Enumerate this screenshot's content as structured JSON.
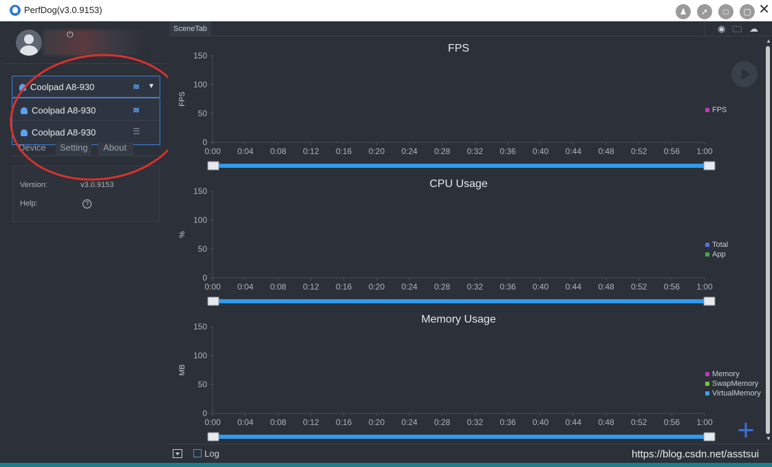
{
  "window": {
    "title": "PerfDog(v3.0.9153)"
  },
  "sidebar": {
    "selected_device": "Coolpad A8-930",
    "device_options": [
      {
        "name": "Coolpad A8-930",
        "connection": "usb"
      },
      {
        "name": "Coolpad A8-930",
        "connection": "wifi"
      }
    ],
    "tabs": [
      "Device",
      "Setting",
      "About"
    ],
    "info": {
      "version_label": "Version:",
      "version_value": "v3.0.9153",
      "help_label": "Help:"
    }
  },
  "main": {
    "scene_tab": "SceneTab",
    "log_label": "Log",
    "watermark": "https://blog.csdn.net/asstsui"
  },
  "colors": {
    "accent": "#3f7ee0",
    "slider": "#2f9bef",
    "fps": "#c038b8",
    "cpu_total": "#5a6fe0",
    "cpu_app": "#3fae49",
    "memory": "#c038b8",
    "swap_memory": "#7bc43a",
    "virtual_memory": "#3f9ff0",
    "annotation_circle": "#d9322a"
  },
  "chart_data": [
    {
      "type": "line",
      "title": "FPS",
      "ylabel": "FPS",
      "xlabel": "",
      "x": [
        "0:00",
        "0:04",
        "0:08",
        "0:12",
        "0:16",
        "0:20",
        "0:24",
        "0:28",
        "0:32",
        "0:36",
        "0:40",
        "0:44",
        "0:48",
        "0:52",
        "0:56",
        "1:00"
      ],
      "yticks": [
        "0",
        "50",
        "100",
        "150"
      ],
      "ylim": [
        0,
        150
      ],
      "legend_position": "right",
      "series": [
        {
          "name": "FPS",
          "values": []
        }
      ]
    },
    {
      "type": "line",
      "title": "CPU Usage",
      "ylabel": "%",
      "xlabel": "",
      "x": [
        "0:00",
        "0:04",
        "0:08",
        "0:12",
        "0:16",
        "0:20",
        "0:24",
        "0:28",
        "0:32",
        "0:36",
        "0:40",
        "0:44",
        "0:48",
        "0:52",
        "0:56",
        "1:00"
      ],
      "yticks": [
        "0",
        "50",
        "100",
        "150"
      ],
      "ylim": [
        0,
        150
      ],
      "legend_position": "right",
      "series": [
        {
          "name": "Total",
          "values": []
        },
        {
          "name": "App",
          "values": []
        }
      ]
    },
    {
      "type": "line",
      "title": "Memory Usage",
      "ylabel": "MB",
      "xlabel": "",
      "x": [
        "0:00",
        "0:04",
        "0:08",
        "0:12",
        "0:16",
        "0:20",
        "0:24",
        "0:28",
        "0:32",
        "0:36",
        "0:40",
        "0:44",
        "0:48",
        "0:52",
        "0:56",
        "1:00"
      ],
      "yticks": [
        "0",
        "50",
        "100",
        "150"
      ],
      "ylim": [
        0,
        150
      ],
      "legend_position": "right",
      "series": [
        {
          "name": "Memory",
          "values": []
        },
        {
          "name": "SwapMemory",
          "values": []
        },
        {
          "name": "VirtualMemory",
          "values": []
        }
      ]
    }
  ]
}
